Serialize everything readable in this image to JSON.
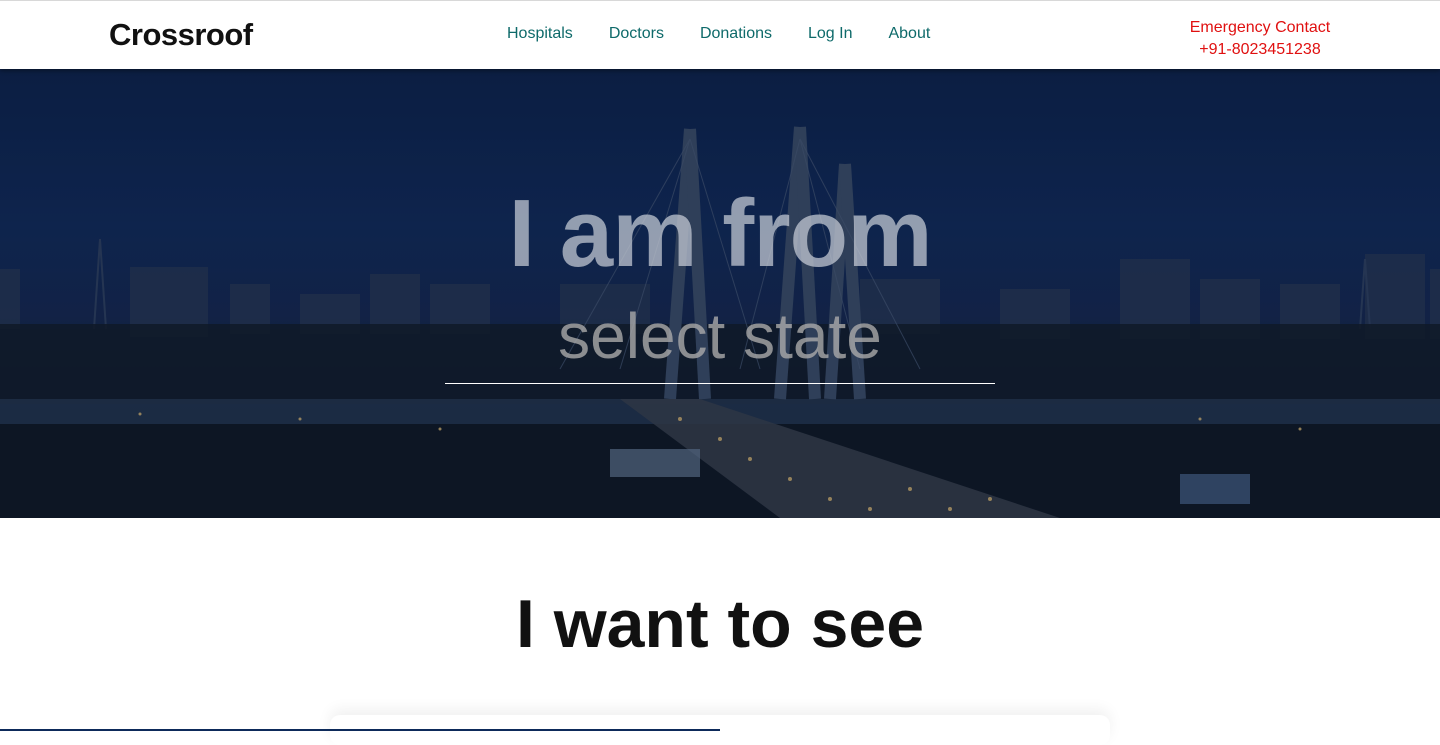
{
  "navbar": {
    "brand": "Crossroof",
    "links": [
      {
        "label": "Hospitals"
      },
      {
        "label": "Doctors"
      },
      {
        "label": "Donations"
      },
      {
        "label": "Log In"
      },
      {
        "label": "About"
      }
    ],
    "emergency": {
      "label": "Emergency Contact",
      "phone": "+91-8023451238"
    }
  },
  "hero": {
    "title": "I am from",
    "select_placeholder": "select state"
  },
  "section": {
    "title": "I want to see"
  },
  "colors": {
    "nav_link": "#0e6a6a",
    "emergency": "#e01010",
    "hero_overlay": "#0f2753"
  }
}
